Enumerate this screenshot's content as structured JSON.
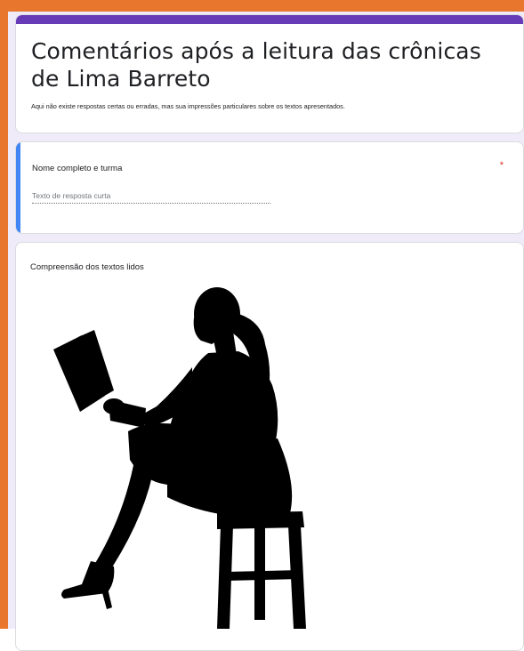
{
  "form": {
    "title": "Comentários após a leitura das crônicas de Lima Barreto",
    "description": "Aqui não existe respostas certas ou erradas, mas sua impressões particulares sobre os textos apresentados."
  },
  "questions": [
    {
      "title": "Nome completo e turma",
      "required_mark": "*",
      "placeholder": "Texto de resposta curta"
    }
  ],
  "image_section": {
    "title": "Compreensão dos textos lidos",
    "image_icon": "woman-reading-silhouette"
  },
  "colors": {
    "frame_border": "#e8762c",
    "theme_accent": "#673ab7",
    "focus_accent": "#4285f4",
    "background": "#f0ebf8",
    "required": "#d93025"
  }
}
